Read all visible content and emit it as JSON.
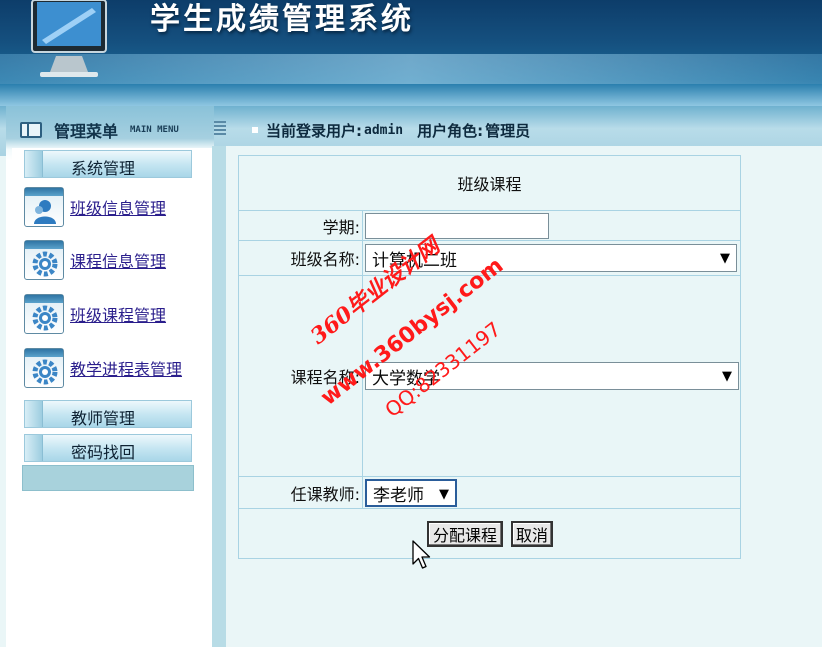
{
  "app": {
    "title": "学生成绩管理系统"
  },
  "menu": {
    "title": "管理菜单",
    "subtitle": "MAIN MENU",
    "sections": [
      {
        "label": "系统管理"
      },
      {
        "label": "教师管理"
      },
      {
        "label": "密码找回"
      }
    ],
    "items": [
      {
        "label": "班级信息管理",
        "icon": "users-icon"
      },
      {
        "label": "课程信息管理",
        "icon": "gear-icon"
      },
      {
        "label": "班级课程管理",
        "icon": "gear-icon"
      },
      {
        "label": "教学进程表管理",
        "icon": "gear-icon"
      }
    ]
  },
  "user": {
    "current_label": "当前登录用户:",
    "current_value": "admin",
    "role_label": "用户角色:",
    "role_value": "管理员"
  },
  "form": {
    "title": "班级课程",
    "semester_label": "学期:",
    "semester_value": "",
    "class_label": "班级名称:",
    "class_value": "计算机二班",
    "course_label": "课程名称:",
    "course_value": "大学数学",
    "teacher_label": "任课教师:",
    "teacher_value": "李老师",
    "submit_label": "分配课程",
    "cancel_label": "取消"
  },
  "watermark": {
    "line1": "360毕业设计网",
    "line2": "www.360bysj.com",
    "line3": "QQ:82331197"
  },
  "colors": {
    "header_dark": "#0d3d6a",
    "link": "#2a1e8c",
    "panel_bg": "#e9f6f7",
    "watermark": "#ff1a1a"
  }
}
